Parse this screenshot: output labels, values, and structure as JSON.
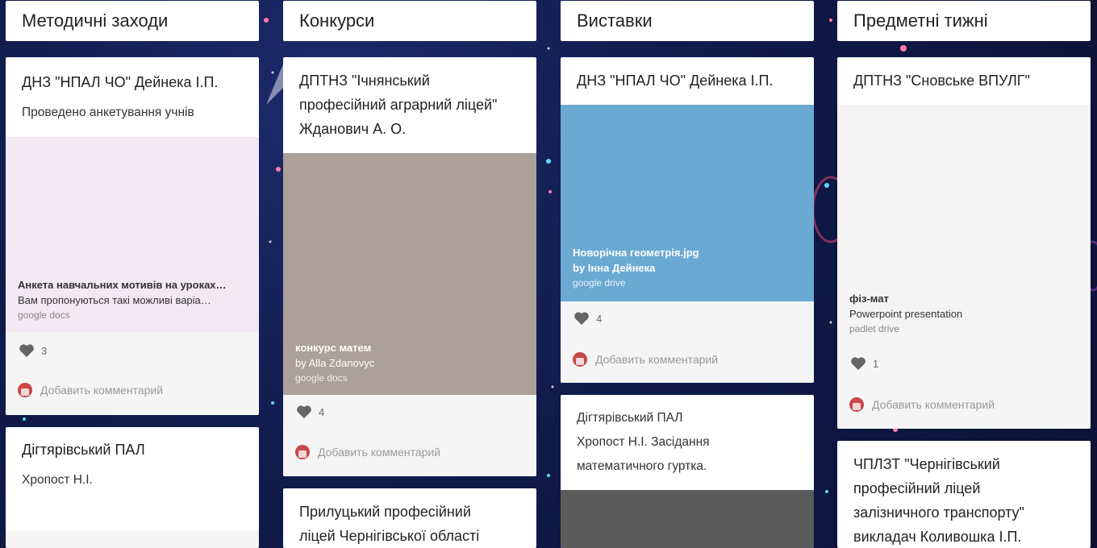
{
  "columns": [
    {
      "title": "Методичні заходи",
      "cards": [
        {
          "title": "ДНЗ \"НПАЛ ЧО\" Дейнека І.П.",
          "body": "Проведено анкетування учнів",
          "attachment": {
            "name": "Анкета навчальних мотивів на уроках…",
            "subtitle": "Вам пропонуються такі можливі варіа…",
            "source": "google docs",
            "color": "#f3e9f3"
          },
          "likes": "3",
          "comment_placeholder": "Добавить комментарий"
        },
        {
          "title": "Дігтярівський ПАЛ",
          "body": "Хропост Н.І."
        }
      ]
    },
    {
      "title": "Конкурси",
      "cards": [
        {
          "title": [
            "ДПТНЗ \"Ічнянський",
            "професійний аграрний ліцей\"",
            "Жданович А. О."
          ],
          "attachment": {
            "name": "конкурс матем",
            "subtitle": "by Alla Zdanovyc",
            "source": "google docs",
            "color": "#aca098"
          },
          "likes": "4",
          "comment_placeholder": "Добавить комментарий"
        },
        {
          "title": [
            "Прилуцький професійний",
            "ліцей Чернігівської області"
          ]
        }
      ]
    },
    {
      "title": "Виставки",
      "cards": [
        {
          "title": "ДНЗ \"НПАЛ ЧО\" Дейнека І.П.",
          "attachment": {
            "name": "Новорічна геометрія.jpg",
            "subtitle": "by Інна Дейнека",
            "source": "google drive",
            "color": "#6aa9d2"
          },
          "likes": "4",
          "comment_placeholder": "Добавить комментарий"
        },
        {
          "body": [
            "Дігтярівський ПАЛ",
            "Хропост Н.І. Засідання",
            "математичного гуртка."
          ],
          "attachment_color": "#5b5b5b"
        }
      ]
    },
    {
      "title": "Предметні тижні",
      "cards": [
        {
          "title": "ДПТНЗ \"Сновське ВПУЛГ\"",
          "attachment": {
            "name": "фіз-мат",
            "subtitle": "Powerpoint presentation",
            "source": "padlet drive",
            "color": "#f4f4f4"
          },
          "likes": "1",
          "comment_placeholder": "Добавить комментарий"
        },
        {
          "title": [
            "ЧПЛЗТ \"Чернігівський",
            "професійний ліцей",
            "залізничного транспорту\"",
            "викладач Коливошка І.П."
          ]
        }
      ]
    }
  ]
}
